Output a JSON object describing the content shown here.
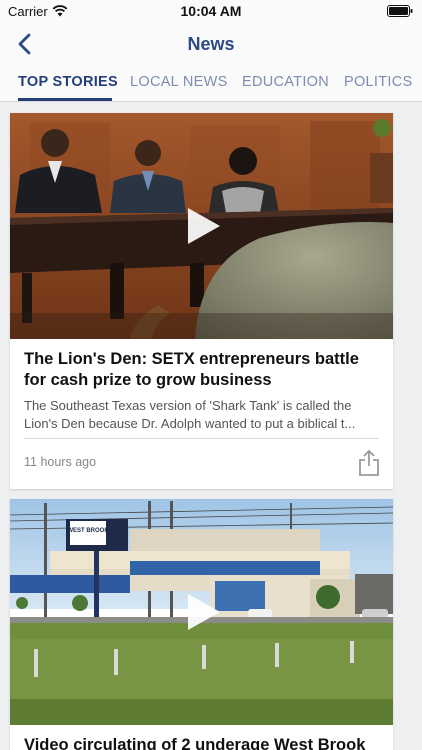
{
  "status_bar": {
    "carrier": "Carrier",
    "time": "10:04 AM",
    "icons": [
      "wifi-icon",
      "battery-icon"
    ]
  },
  "nav": {
    "title": "News",
    "back_icon": "chevron-left-icon",
    "accent_color": "#2d4a86"
  },
  "tabs": [
    {
      "label": "TOP STORIES",
      "active": true
    },
    {
      "label": "LOCAL NEWS",
      "active": false
    },
    {
      "label": "EDUCATION",
      "active": false
    },
    {
      "label": "POLITICS",
      "active": false
    }
  ],
  "articles": [
    {
      "title": "The Lion's Den: SETX entrepreneurs battle for cash prize to grow business",
      "summary": "The Southeast Texas version of 'Shark Tank' is called the Lion's Den because Dr. Adolph wanted to put a biblical t...",
      "time": "11 hours ago",
      "has_video": true
    },
    {
      "title": "Video circulating of 2 underage West Brook",
      "sign_text": "WEST BROOK",
      "has_video": true
    }
  ]
}
